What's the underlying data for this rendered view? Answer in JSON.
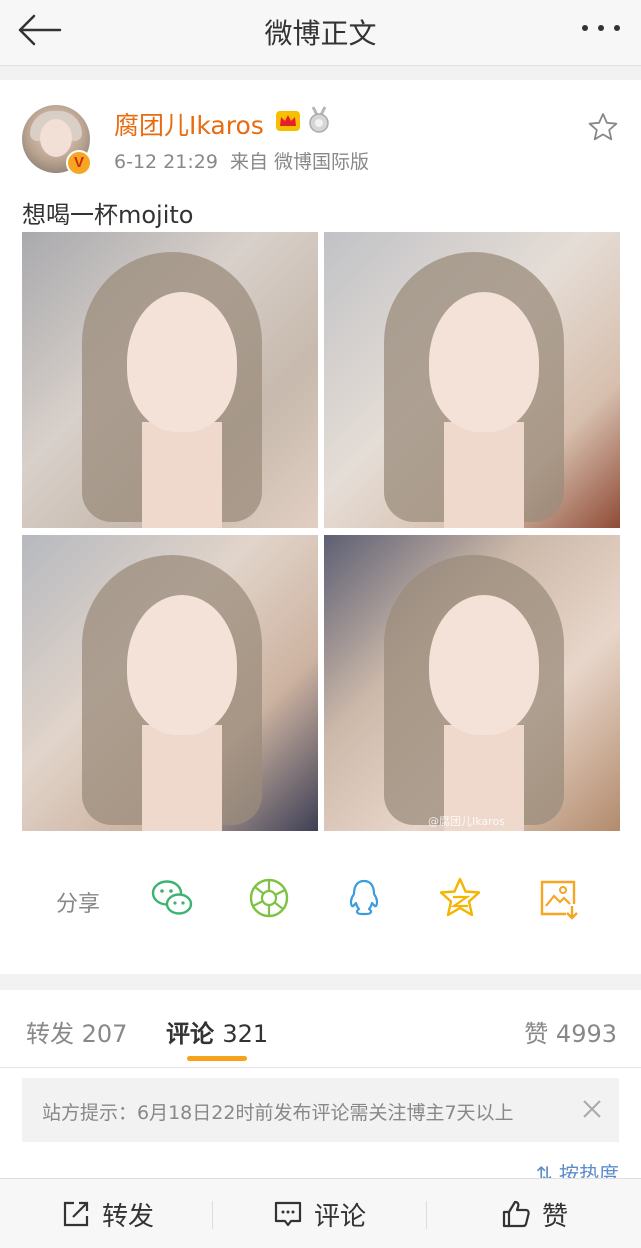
{
  "header": {
    "title": "微博正文"
  },
  "post": {
    "username": "腐团儿Ikaros",
    "verified_badge": "V",
    "time": "6-12 21:29",
    "source": "来自 微博国际版",
    "text": "想喝一杯mojito",
    "watermark": "@腐团儿Ikaros",
    "photos": [
      "photo-1",
      "photo-2",
      "photo-3",
      "photo-4"
    ]
  },
  "share": {
    "label": "分享",
    "targets": [
      "wechat-icon",
      "moments-icon",
      "qq-icon",
      "qzone-icon",
      "save-image-icon"
    ]
  },
  "stats": {
    "repost_label": "转发",
    "repost_count": "207",
    "comment_label": "评论",
    "comment_count": "321",
    "like_label": "赞",
    "like_count": "4993",
    "active_tab": "评论"
  },
  "notice": {
    "text": "站方提示：6月18日22时前发布评论需关注博主7天以上"
  },
  "sort_label": "按热度",
  "bottom": {
    "repost": "转发",
    "comment": "评论",
    "like": "赞"
  },
  "colors": {
    "username": "#e86b0f",
    "accent": "#f7a21b",
    "wechat": "#3cb371",
    "moments": "#7dc242",
    "qq": "#3a9be0",
    "qzone": "#f5b400",
    "save": "#f5a623"
  }
}
